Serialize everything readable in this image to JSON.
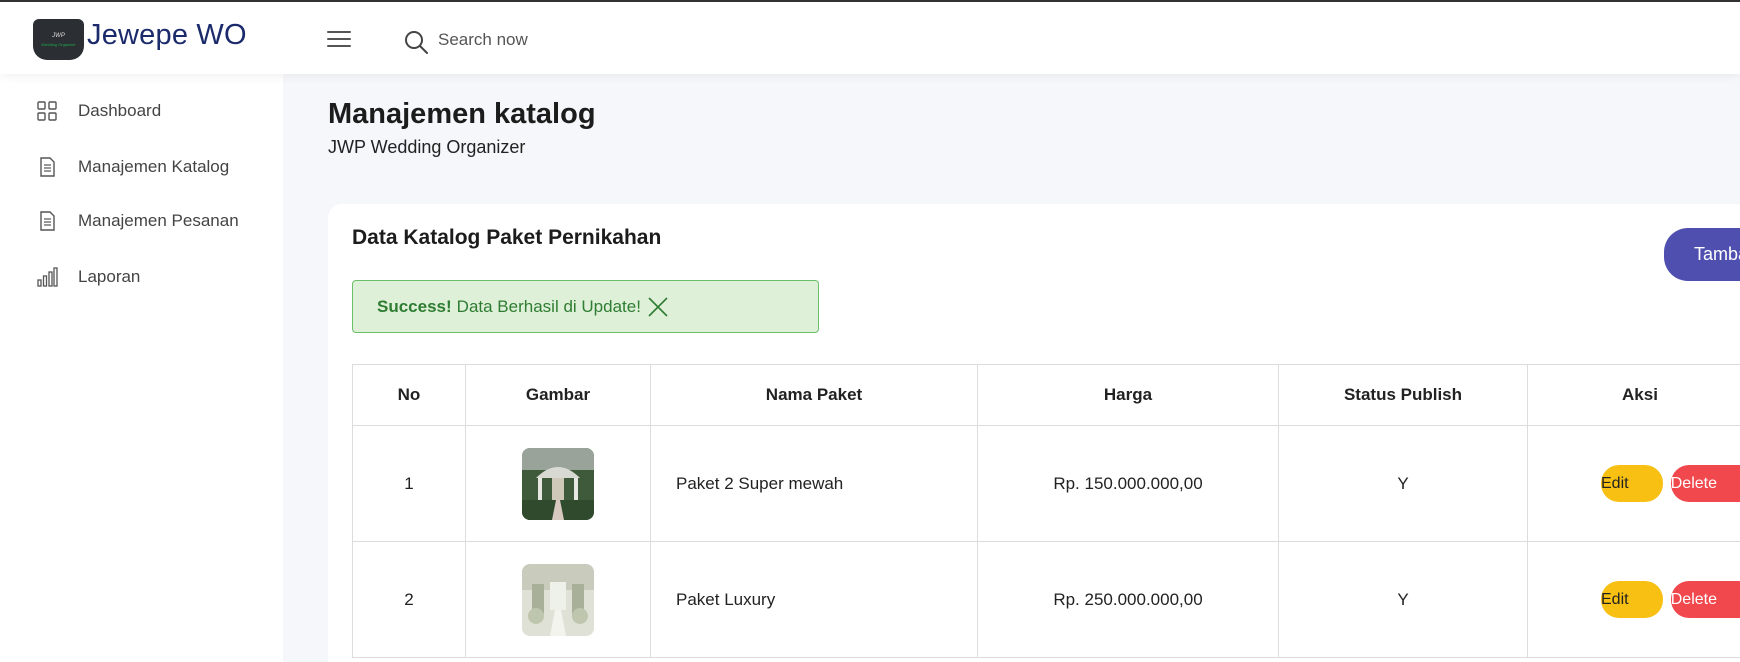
{
  "header": {
    "logo_text_top": "JWP",
    "logo_text_bottom": "Wedding Organizer",
    "brand": "Jewepe WO",
    "search_placeholder": "Search now"
  },
  "sidebar": {
    "items": [
      {
        "label": "Dashboard",
        "icon": "grid-icon"
      },
      {
        "label": "Manajemen Katalog",
        "icon": "document-icon"
      },
      {
        "label": "Manajemen Pesanan",
        "icon": "document-icon"
      },
      {
        "label": "Laporan",
        "icon": "bar-chart-icon"
      }
    ]
  },
  "page": {
    "title": "Manajemen katalog",
    "subtitle": "JWP Wedding Organizer"
  },
  "card": {
    "title": "Data Katalog Paket Pernikahan",
    "add_button": "Tambah",
    "alert": {
      "strong": "Success!",
      "message": "Data Berhasil di Update!"
    },
    "table": {
      "headers": [
        "No",
        "Gambar",
        "Nama Paket",
        "Harga",
        "Status Publish",
        "Aksi"
      ],
      "rows": [
        {
          "no": "1",
          "name": "Paket 2 Super mewah",
          "price": "Rp. 150.000.000,00",
          "status": "Y",
          "edit": "Edit",
          "delete": "Delete"
        },
        {
          "no": "2",
          "name": "Paket Luxury",
          "price": "Rp. 250.000.000,00",
          "status": "Y",
          "edit": "Edit",
          "delete": "Delete"
        }
      ]
    }
  },
  "colors": {
    "brand": "#1b2a6b",
    "primary_button": "#4f4fb0",
    "edit_button": "#f7c012",
    "delete_button": "#f0484d",
    "alert_bg": "#dff0d8",
    "alert_text": "#2e7d32"
  }
}
